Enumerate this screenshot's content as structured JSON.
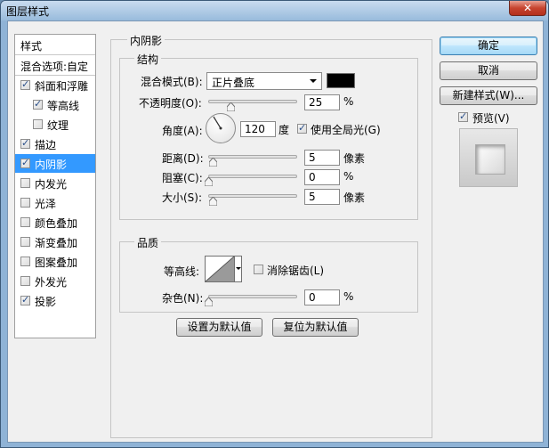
{
  "window": {
    "title": "图层样式",
    "close": "✕"
  },
  "list": {
    "header": "样式",
    "blend_options": "混合选项:自定",
    "items": [
      {
        "label": "斜面和浮雕",
        "checked": true
      },
      {
        "label": "等高线",
        "checked": true
      },
      {
        "label": "纹理",
        "checked": false
      },
      {
        "label": "描边",
        "checked": true
      },
      {
        "label": "内阴影",
        "checked": true
      },
      {
        "label": "内发光",
        "checked": false
      },
      {
        "label": "光泽",
        "checked": false
      },
      {
        "label": "颜色叠加",
        "checked": false
      },
      {
        "label": "渐变叠加",
        "checked": false
      },
      {
        "label": "图案叠加",
        "checked": false
      },
      {
        "label": "外发光",
        "checked": false
      },
      {
        "label": "投影",
        "checked": true
      }
    ],
    "selected": "内阴影"
  },
  "panel": {
    "title": "内阴影",
    "structure": {
      "title": "结构",
      "blend_mode_label": "混合模式(B):",
      "blend_mode_value": "正片叠底",
      "blend_color": "#000000",
      "opacity_label": "不透明度(O):",
      "opacity_value": "25",
      "opacity_unit": "%",
      "opacity_fraction": 0.25,
      "angle_label": "角度(A):",
      "angle_value": "120",
      "angle_unit": "度",
      "global_light_label": "使用全局光(G)",
      "global_light_checked": true,
      "distance_label": "距离(D):",
      "distance_value": "5",
      "distance_unit": "像素",
      "choke_label": "阻塞(C):",
      "choke_value": "0",
      "choke_unit": "%",
      "size_label": "大小(S):",
      "size_value": "5",
      "size_unit": "像素"
    },
    "quality": {
      "title": "品质",
      "contour_label": "等高线:",
      "antialias_label": "消除锯齿(L)",
      "antialias_checked": false,
      "noise_label": "杂色(N):",
      "noise_value": "0",
      "noise_unit": "%"
    },
    "set_default": "设置为默认值",
    "reset_default": "复位为默认值"
  },
  "buttons": {
    "ok": "确定",
    "cancel": "取消",
    "new_style": "新建样式(W)...",
    "preview_label": "预览(V)",
    "preview_checked": true
  }
}
